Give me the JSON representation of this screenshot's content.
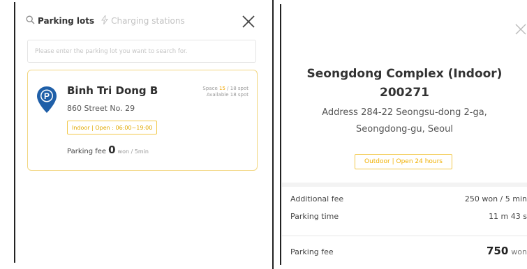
{
  "left_panel": {
    "tabs": [
      {
        "label": "Parking lots",
        "icon": "search-icon",
        "active": true
      },
      {
        "label": "Charging stations",
        "icon": "lightning-icon",
        "active": false
      }
    ],
    "search": {
      "placeholder": "Please enter the parking lot you want to search for."
    },
    "lot": {
      "name": "Binh Tri Dong B",
      "address": "860 Street No. 29",
      "tag": "Indoor | Open : 06:00~19:00",
      "space_label": "Space",
      "space_used": "15",
      "space_total": "18 spot",
      "available_label": "Available",
      "available_value": "18 spot",
      "fee_label": "Parking fee",
      "fee_value": "0",
      "fee_unit": "won / 5min"
    }
  },
  "right_panel": {
    "title_line1": "Seongdong Complex (Indoor)",
    "title_line2": "200271",
    "address_line1": "Address 284-22 Seongsu-dong 2-ga,",
    "address_line2": "Seongdong-gu, Seoul",
    "tag": "Outdoor | Open 24 hours",
    "additional_fee_label": "Additional fee",
    "additional_fee_value": "250 won / 5 min",
    "parking_time_label": "Parking time",
    "parking_time_value": "11 m 43 s",
    "parking_fee_label": "Parking fee",
    "parking_fee_value": "750",
    "parking_fee_unit": "won"
  },
  "colors": {
    "accent_yellow": "#f2c94c",
    "pin_blue": "#1f5fa8"
  }
}
